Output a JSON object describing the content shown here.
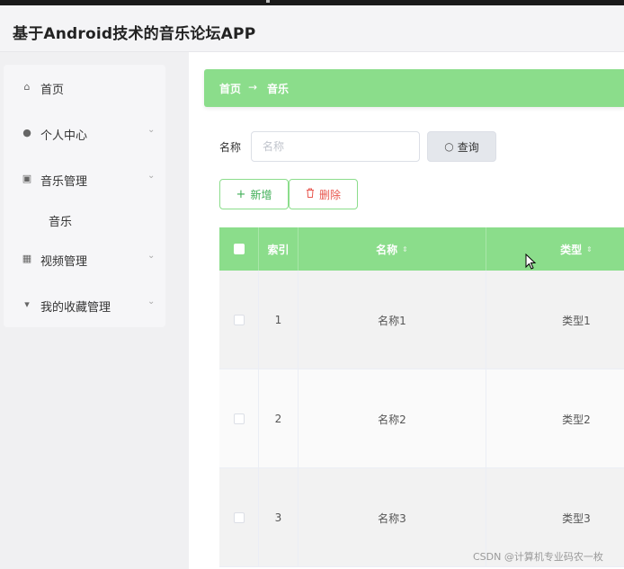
{
  "app": {
    "title": "基于Android技术的音乐论坛APP"
  },
  "sidebar": {
    "items": [
      {
        "label": "首页",
        "icon": "home-icon",
        "glyph": "⌂",
        "has_arrow": false
      },
      {
        "label": "个人中心",
        "icon": "user-icon",
        "glyph": "●",
        "has_arrow": true
      },
      {
        "label": "音乐管理",
        "icon": "music-manage-icon",
        "glyph": "▣",
        "has_arrow": true
      },
      {
        "label": "视频管理",
        "icon": "grid-icon",
        "glyph": "▦",
        "has_arrow": true
      },
      {
        "label": "我的收藏管理",
        "icon": "favorite-icon",
        "glyph": "▾",
        "has_arrow": true
      }
    ],
    "sub_items": [
      {
        "label": "音乐"
      }
    ],
    "arrow_glyph": "⌄"
  },
  "breadcrumb": {
    "home": "首页",
    "separator": "→",
    "current": "音乐"
  },
  "search": {
    "label": "名称",
    "placeholder": "名称",
    "value": "",
    "button": "查询"
  },
  "actions": {
    "add": "新增",
    "delete": "删除"
  },
  "table": {
    "columns": [
      {
        "key": "select",
        "label": ""
      },
      {
        "key": "index",
        "label": "索引"
      },
      {
        "key": "name",
        "label": "名称",
        "sortable": true
      },
      {
        "key": "type",
        "label": "类型",
        "sortable": true
      }
    ],
    "rows": [
      {
        "index": "1",
        "name": "名称1",
        "type": "类型1"
      },
      {
        "index": "2",
        "name": "名称2",
        "type": "类型2"
      },
      {
        "index": "3",
        "name": "名称3",
        "type": "类型3"
      }
    ]
  },
  "watermark": "CSDN @计算机专业码农一枚",
  "colors": {
    "accent": "#8bdd8b",
    "add_text": "#3fae56",
    "delete_text": "#e8574f",
    "sidebar_bg": "#f0f0f2"
  }
}
